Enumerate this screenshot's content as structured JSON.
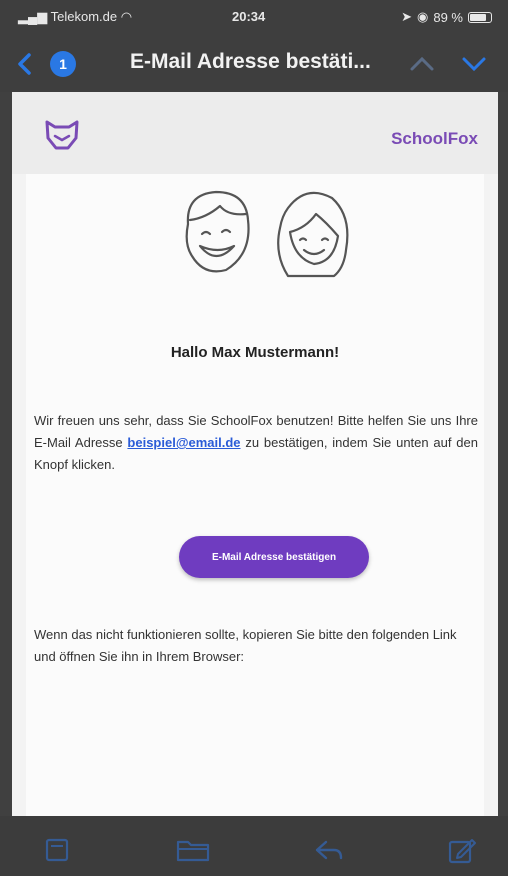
{
  "status": {
    "carrier": "Telekom.de",
    "time": "20:34",
    "battery": "89 %"
  },
  "nav": {
    "unread_count": "1",
    "title": "E-Mail Adresse bestäti..."
  },
  "email": {
    "brand": "SchoolFox",
    "greeting": "Hallo Max Mustermann!",
    "para1_before": "Wir freuen uns sehr, dass Sie SchoolFox benutzen! Bitte helfen Sie uns Ihre E-Mail Adresse ",
    "email_link": "beispiel@email.de",
    "para1_after": " zu bestätigen, indem Sie unten auf den Knopf klicken.",
    "confirm_button": "E-Mail Adresse bestätigen",
    "para2": "Wenn das nicht funktionieren sollte, kopieren Sie bitte den folgenden Link und öffnen Sie ihn in Ihrem Browser:"
  },
  "colors": {
    "accent": "#6f3cc0",
    "brand": "#7a4bb5",
    "ios_blue": "#2a78e4",
    "link": "#2a5bd7"
  },
  "toolbar": {
    "icons": [
      "flag-icon",
      "folder-icon",
      "reply-icon",
      "compose-icon"
    ]
  }
}
